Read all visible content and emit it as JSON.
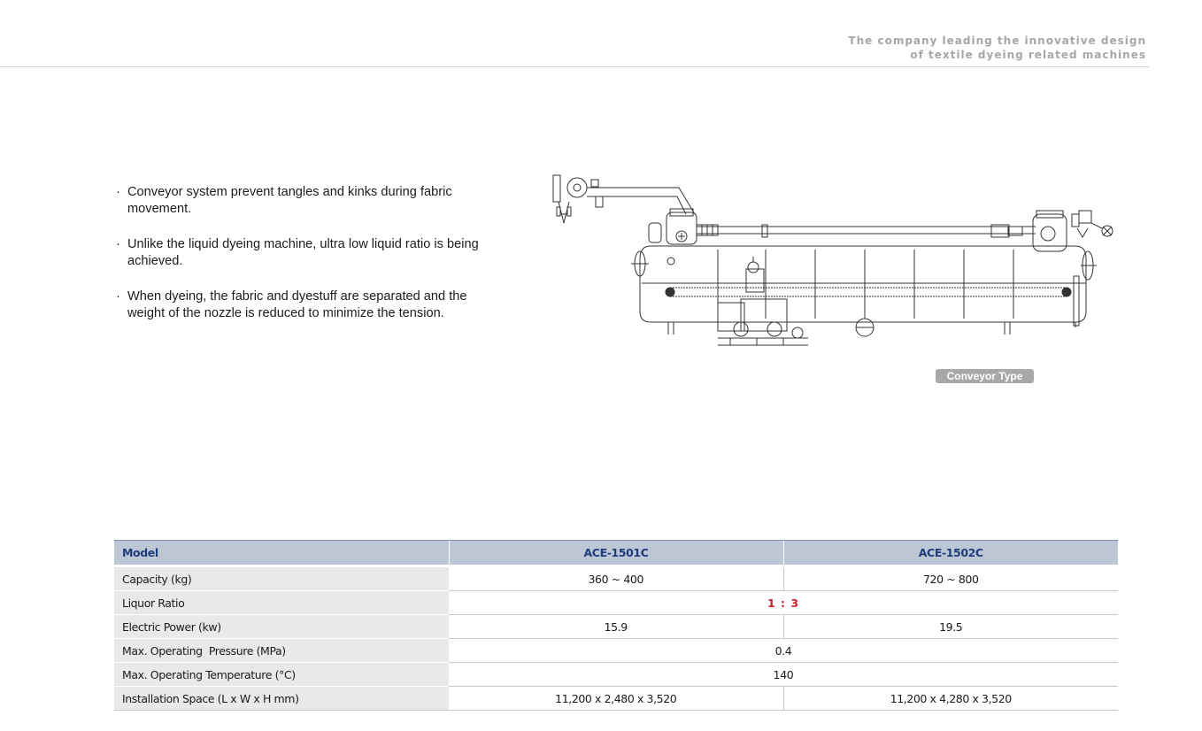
{
  "header": {
    "tagline_line1": "The company leading the innovative design",
    "tagline_line2": "of textile dyeing related machines"
  },
  "features": [
    {
      "bullet": "·",
      "text": "Conveyor system prevent tangles and kinks during fabric movement."
    },
    {
      "bullet": "·",
      "text": "Unlike the liquid dyeing machine, ultra low liquid ratio is being achieved."
    },
    {
      "bullet": "·",
      "text": "When dyeing, the fabric and dyestuff are separated and the weight of the nozzle is reduced to minimize the tension."
    }
  ],
  "diagram": {
    "caption": "Conveyor Type"
  },
  "specs": {
    "headers": [
      "Model",
      "ACE-1501C",
      "ACE-1502C"
    ],
    "rows": {
      "capacity": {
        "label": "Capacity (kg)",
        "a": "360 ~ 400",
        "b": "720 ~ 800"
      },
      "liquor": {
        "label": "Liquor Ratio",
        "value": "1 : 3"
      },
      "power": {
        "label": "Electric Power (kw)",
        "a": "15.9",
        "b": "19.5"
      },
      "pressure": {
        "label": "Max. Operating  Pressure (MPa)",
        "value": "0.4"
      },
      "temperature": {
        "label": "Max. Operating Temperature (°C)",
        "value": "140"
      },
      "space": {
        "label": "Installation Space (L x W x H mm)",
        "a": "11,200 x 2,480 x 3,520",
        "b": "11,200 x 4,280 x 3,520"
      }
    }
  },
  "colors": {
    "header_bg": "#bcc6d4",
    "header_text": "#1f3d7a",
    "accent_red": "#c8232c",
    "caption_bg": "#a8a8a8",
    "tagline": "#a7a7a7"
  }
}
